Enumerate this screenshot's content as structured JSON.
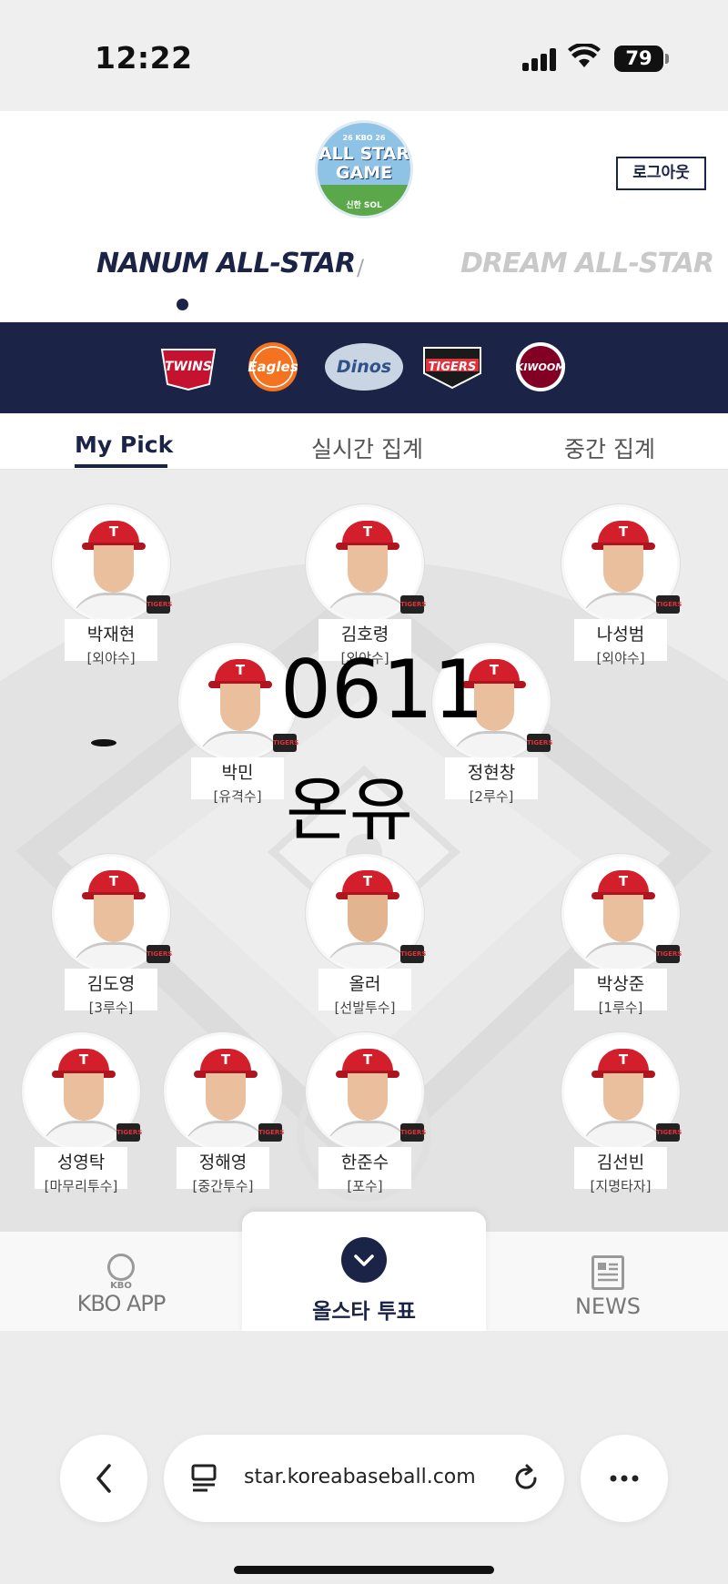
{
  "status_bar": {
    "time": "12:22",
    "battery": "79"
  },
  "header": {
    "logo": {
      "top": "26 KBO 26",
      "main_line1": "ALL STAR",
      "main_line2": "GAME",
      "bottom": "신한 SOL"
    },
    "logout_label": "로그아웃",
    "league_left": "NANUM ALL-STAR",
    "league_separator": "/",
    "league_right": "DREAM ALL-STAR"
  },
  "teams": [
    "TWINS",
    "Eagles",
    "Dinos",
    "TIGERS",
    "KIWOOM"
  ],
  "tabs": [
    {
      "label": "My Pick",
      "active": true
    },
    {
      "label": "실시간 집계",
      "active": false
    },
    {
      "label": "중간 집계",
      "active": false
    }
  ],
  "players": [
    {
      "name": "박재현",
      "position": "[외야수]"
    },
    {
      "name": "김호령",
      "position": "[외야수]"
    },
    {
      "name": "나성범",
      "position": "[외야수]"
    },
    {
      "name": "박민",
      "position": "[유격수]"
    },
    {
      "name": "정현창",
      "position": "[2루수]"
    },
    {
      "name": "김도영",
      "position": "[3루수]"
    },
    {
      "name": "올러",
      "position": "[선발투수]"
    },
    {
      "name": "박상준",
      "position": "[1루수]"
    },
    {
      "name": "성영탁",
      "position": "[마무리투수]"
    },
    {
      "name": "정해영",
      "position": "[중간투수]"
    },
    {
      "name": "한준수",
      "position": "[포수]"
    },
    {
      "name": "김선빈",
      "position": "[지명타자]"
    }
  ],
  "player_team_badge": "TIGERS",
  "overlay": {
    "number": "0611",
    "name": "온유"
  },
  "bottom_nav": {
    "kbo_small": "KBO",
    "kbo_label": "KBO APP",
    "vote_label": "올스타 투표",
    "news_label": "NEWS"
  },
  "browser": {
    "url": "star.koreabaseball.com"
  },
  "colors": {
    "navy": "#1b2347",
    "tigers_red": "#d21f2b"
  }
}
